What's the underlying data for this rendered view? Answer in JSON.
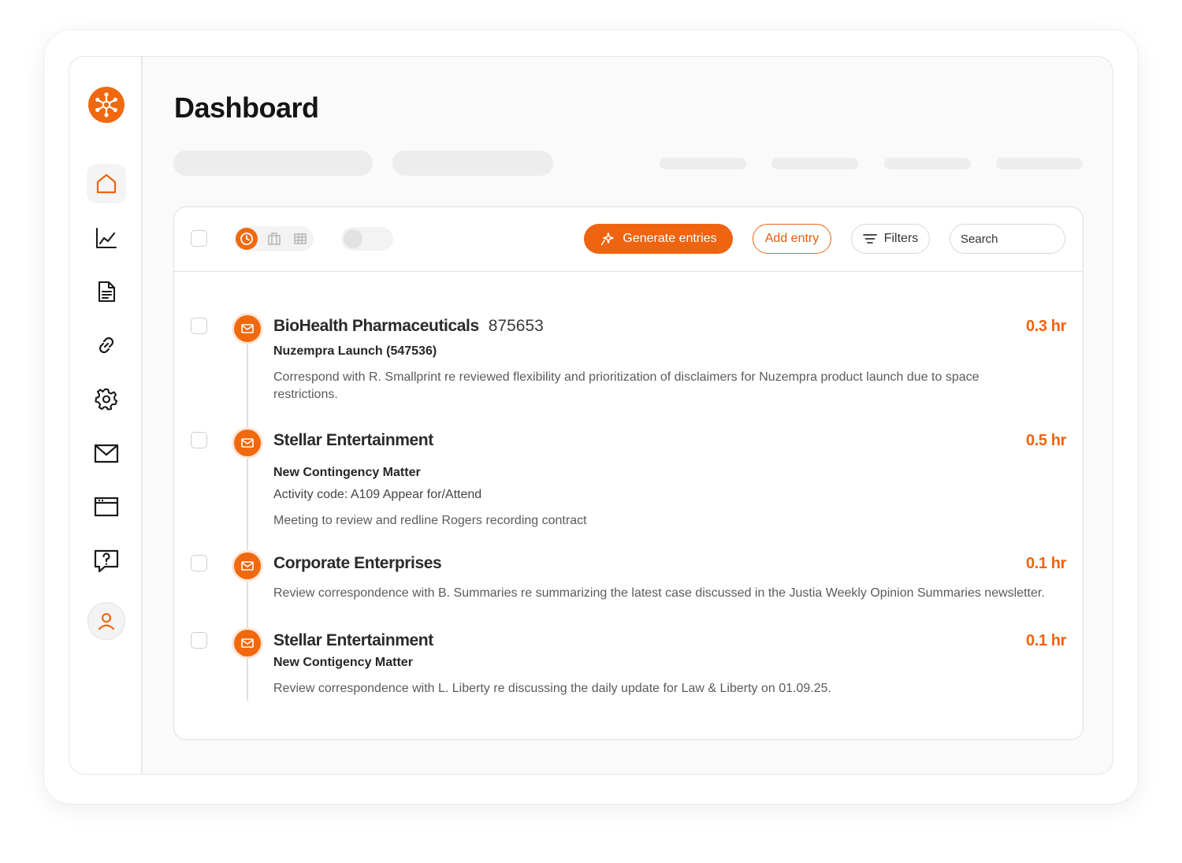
{
  "page": {
    "title": "Dashboard"
  },
  "sidebar": {
    "items": [
      {
        "name": "home",
        "icon": "home-icon",
        "active": true
      },
      {
        "name": "analytics",
        "icon": "line-chart-icon"
      },
      {
        "name": "documents",
        "icon": "document-icon"
      },
      {
        "name": "integrations",
        "icon": "link-icon"
      },
      {
        "name": "settings",
        "icon": "gear-icon"
      },
      {
        "name": "mail",
        "icon": "mail-icon"
      },
      {
        "name": "browser",
        "icon": "window-icon"
      },
      {
        "name": "help",
        "icon": "help-icon"
      }
    ],
    "avatar_icon": "user-icon"
  },
  "toolbar": {
    "generate_label": "Generate entries",
    "add_label": "Add entry",
    "filters_label": "Filters",
    "search_placeholder": "Search"
  },
  "colors": {
    "accent": "#ee6410",
    "accent_light": "#fde6d6",
    "border": "#dedede"
  },
  "entries": [
    {
      "client": "BioHealth Pharmaceuticals",
      "number": "875653",
      "hours": "0.3 hr",
      "matter": "Nuzempra Launch (547536)",
      "description": "Correspond with R. Smallprint re reviewed flexibility and prioritization of disclaimers for Nuzempra product launch due to space restrictions."
    },
    {
      "client": "Stellar Entertainment",
      "hours": "0.5 hr",
      "matter": "New Contingency Matter",
      "activity": "Activity code: A109 Appear for/Attend",
      "description": "Meeting to review and redline Rogers recording contract"
    },
    {
      "client": "Corporate Enterprises",
      "hours": "0.1 hr",
      "description": "Review correspondence with B. Summaries re summarizing the latest case discussed in the Justia Weekly Opinion Summaries newsletter."
    },
    {
      "client": "Stellar Entertainment",
      "hours": "0.1 hr",
      "matter": "New Contigency Matter",
      "description": "Review correspondence with L. Liberty re discussing the daily update for Law & Liberty on 01.09.25."
    }
  ]
}
